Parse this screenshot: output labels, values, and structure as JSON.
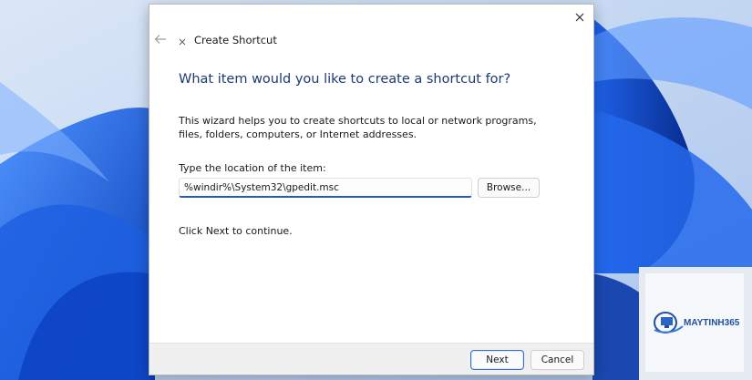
{
  "window": {
    "title": "Create Shortcut",
    "close_icon": "close-icon",
    "back_icon": "back-arrow-icon",
    "app_icon": "shortcut-app-icon"
  },
  "main": {
    "heading": "What item would you like to create a shortcut for?",
    "description": "This wizard helps you to create shortcuts to local or network programs, files, folders, computers, or Internet addresses.",
    "location_label": "Type the location of the item:",
    "location_value": "%windir%\\System32\\gpedit.msc",
    "browse_label": "Browse...",
    "continue_text": "Click Next to continue."
  },
  "footer": {
    "next_label": "Next",
    "cancel_label": "Cancel"
  },
  "watermark": {
    "brand": "MAYTINH365"
  },
  "colors": {
    "heading": "#1c3a73",
    "accent": "#1f5cc0",
    "wallpaper": "#1a56d6"
  }
}
